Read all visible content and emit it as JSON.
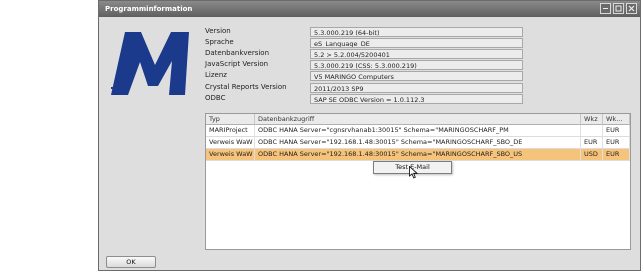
{
  "window": {
    "title": "Programminformation"
  },
  "info": [
    {
      "label": "Version",
      "value": "5.3.000.219 (64-bit)"
    },
    {
      "label": "Sprache",
      "value": "eS_Language_DE"
    },
    {
      "label": "Datenbankversion",
      "value": "5.2 > 5.2.004/5200401"
    },
    {
      "label": "JavaScript Version",
      "value": "5.3.000.219 (CSS: 5.3.000.219)"
    },
    {
      "label": "Lizenz",
      "value": "V5 MARINGO Computers"
    },
    {
      "label": "Crystal Reports Version",
      "value": "2011/2013 SP9"
    },
    {
      "label": "ODBC",
      "value": "SAP SE ODBC Version = 1.0.112.3"
    }
  ],
  "grid": {
    "headers": [
      "Typ",
      "Datenbankzugriff",
      "Wkz",
      "Wk..."
    ],
    "rows": [
      {
        "typ": "MARIProject",
        "db": "ODBC HANA Server=\"cgnsrvhanab1:30015\" Schema=\"MARINGOSCHARF_PM",
        "wkz": "",
        "wk": "EUR",
        "selected": false
      },
      {
        "typ": "Verweis WaW",
        "db": "ODBC HANA Server=\"192.168.1.48:30015\" Schema=\"MARINGOSCHARF_SBO_DE",
        "wkz": "EUR",
        "wk": "EUR",
        "selected": false
      },
      {
        "typ": "Verweis WaW",
        "db": "ODBC HANA Server=\"192.168.1.48:30015\" Schema=\"MARINGOSCHARF_SBO_US",
        "wkz": "USD",
        "wk": "EUR",
        "selected": true
      }
    ]
  },
  "context_menu": {
    "item": "Test E-Mail"
  },
  "ok_label": "OK",
  "colors": {
    "titlebar": "#6f6f6f",
    "selection": "#f6c37a",
    "logo": "#1b3a8c"
  }
}
